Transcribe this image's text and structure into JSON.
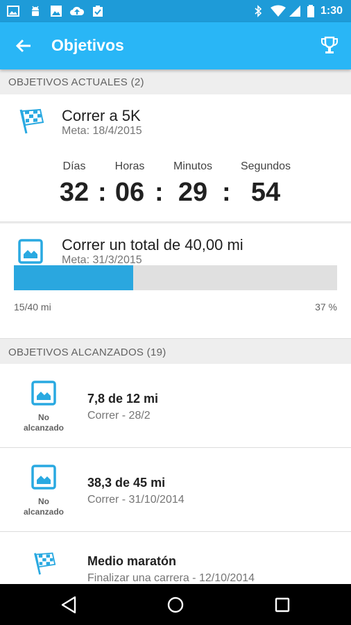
{
  "status_bar": {
    "time": "1:30"
  },
  "app_bar": {
    "title": "Objetivos"
  },
  "current_section": {
    "header": "OBJETIVOS ACTUALES (2)"
  },
  "goal_5k": {
    "title": "Correr a 5K",
    "meta": "Meta: 18/4/2015",
    "countdown": {
      "labels": [
        "Días",
        "Horas",
        "Minutos",
        "Segundos"
      ],
      "values": [
        "32",
        "06",
        "29",
        "54"
      ],
      "separator": ":"
    }
  },
  "goal_total": {
    "title": "Correr un total de 40,00 mi",
    "meta": "Meta: 31/3/2015",
    "progress_fraction": 0.37,
    "progress_text": "15/40 mi",
    "percent_text": "37 %"
  },
  "achieved_section": {
    "header": "OBJETIVOS ALCANZADOS (19)",
    "items": [
      {
        "icon": "chart-icon",
        "status_line1": "No",
        "status_line2": "alcanzado",
        "title": "7,8 de 12 mi",
        "subtitle": "Correr - 28/2"
      },
      {
        "icon": "chart-icon",
        "status_line1": "No",
        "status_line2": "alcanzado",
        "title": "38,3 de 45 mi",
        "subtitle": "Correr - 31/10/2014"
      },
      {
        "icon": "flag-icon",
        "status_line1": "",
        "status_line2": "",
        "title": "Medio maratón",
        "subtitle": "Finalizar una carrera - 12/10/2014"
      }
    ]
  },
  "colors": {
    "app_bar": "#29b6f6",
    "status_bar": "#1e9bd8",
    "progress_fill": "#2aa7df",
    "icon_accent": "#29a9e1"
  }
}
